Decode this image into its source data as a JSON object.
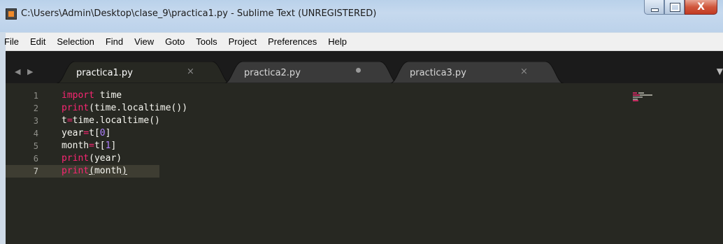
{
  "window": {
    "title": "C:\\Users\\Admin\\Desktop\\clase_9\\practica1.py - Sublime Text (UNREGISTERED)",
    "minimize_icon": "minimize-icon",
    "maximize_icon": "maximize-icon",
    "close_glyph": "X"
  },
  "menu": [
    "File",
    "Edit",
    "Selection",
    "Find",
    "View",
    "Goto",
    "Tools",
    "Project",
    "Preferences",
    "Help"
  ],
  "tabs": [
    {
      "label": "practica1.py",
      "active": true,
      "button": "×",
      "modified": false
    },
    {
      "label": "practica2.py",
      "active": false,
      "button": "",
      "modified": true
    },
    {
      "label": "practica3.py",
      "active": false,
      "button": "×",
      "modified": false
    }
  ],
  "tab_nav": "◀ ▶",
  "tab_overflow": "▼",
  "editor": {
    "current_line": 7,
    "line_numbers": [
      "1",
      "2",
      "3",
      "4",
      "5",
      "6",
      "7"
    ],
    "lines": [
      [
        {
          "t": "import",
          "c": "kw"
        },
        {
          "t": " time",
          "c": "plain"
        }
      ],
      [
        {
          "t": "print",
          "c": "fn"
        },
        {
          "t": "(time.localtime())",
          "c": "plain"
        }
      ],
      [
        {
          "t": "t",
          "c": "plain"
        },
        {
          "t": "=",
          "c": "op"
        },
        {
          "t": "time.localtime()",
          "c": "plain"
        }
      ],
      [
        {
          "t": "year",
          "c": "plain"
        },
        {
          "t": "=",
          "c": "op"
        },
        {
          "t": "t[",
          "c": "plain"
        },
        {
          "t": "0",
          "c": "num"
        },
        {
          "t": "]",
          "c": "plain"
        }
      ],
      [
        {
          "t": "month",
          "c": "plain"
        },
        {
          "t": "=",
          "c": "op"
        },
        {
          "t": "t[",
          "c": "plain"
        },
        {
          "t": "1",
          "c": "num"
        },
        {
          "t": "]",
          "c": "plain"
        }
      ],
      [
        {
          "t": "print",
          "c": "fn"
        },
        {
          "t": "(year)",
          "c": "plain"
        }
      ],
      [
        {
          "t": "print",
          "c": "fn"
        },
        {
          "t": "(",
          "c": "plain u"
        },
        {
          "t": "month",
          "c": "plain"
        },
        {
          "t": ")",
          "c": "plain u"
        }
      ]
    ]
  },
  "colors": {
    "editor_bg": "#272822",
    "tabbar_bg": "#1b1b1b",
    "active_tab": "#272822",
    "inactive_tab": "#3a3a3a",
    "keyword": "#f92672",
    "number": "#ae81ff"
  }
}
